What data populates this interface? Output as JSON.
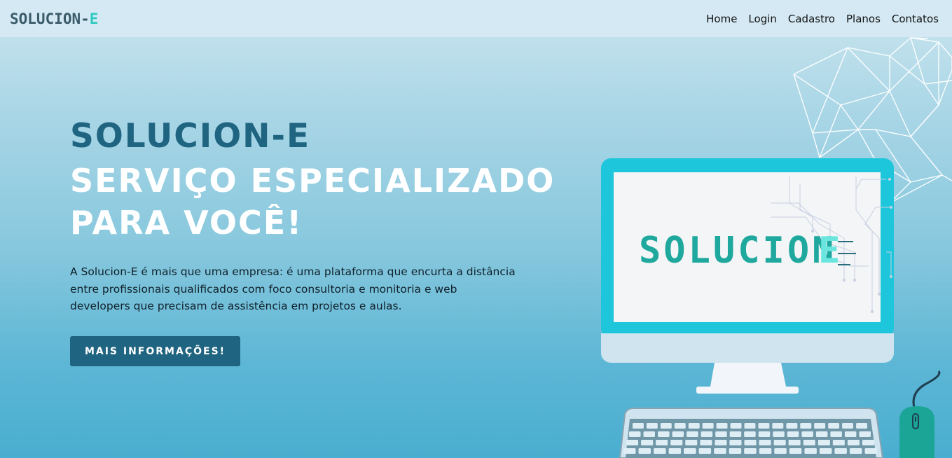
{
  "brand": {
    "logo_main": "SOLUCION-",
    "logo_accent": "E",
    "screen_logo_main": "SOLUCION",
    "screen_logo_accent": "E"
  },
  "nav": {
    "items": [
      {
        "label": "Home"
      },
      {
        "label": "Login"
      },
      {
        "label": "Cadastro"
      },
      {
        "label": "Planos"
      },
      {
        "label": "Contatos"
      }
    ]
  },
  "hero": {
    "title": "SOLUCION-E",
    "subtitle_line1": "SERVIÇO ESPECIALIZADO",
    "subtitle_line2": "PARA VOCÊ!",
    "description": "A Solucion-E é mais que uma empresa: é uma plataforma que encurta a distância entre profissionais qualificados com foco consultoria e monitoria e web developers que precisam de assistência em projetos e aulas.",
    "cta_label": "MAIS INFORMAÇÕES!"
  },
  "colors": {
    "primary": "#1f6480",
    "accent": "#2ec9c1",
    "monitor_frame": "#1ec6dc",
    "navbar_bg": "#d4e9f3"
  },
  "icons": [
    "computer-illustration",
    "network-mesh-graphic",
    "mouse-icon",
    "keyboard-graphic"
  ]
}
